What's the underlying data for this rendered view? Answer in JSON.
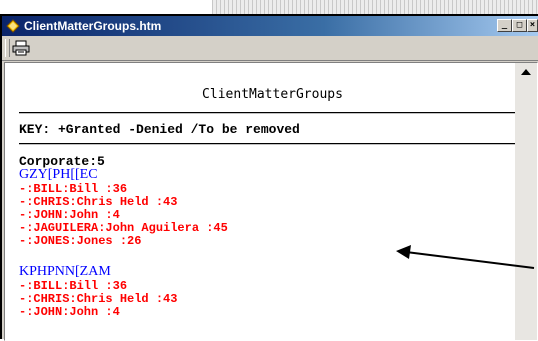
{
  "window": {
    "title": "ClientMatterGroups.htm",
    "controls": {
      "minimize": "_",
      "maximize": "□",
      "close": "×"
    }
  },
  "toolbar": {
    "print_icon": "printer-icon"
  },
  "document": {
    "title": "ClientMatterGroups",
    "key_line": "KEY: +Granted -Denied /To be removed",
    "section_header": "Corporate:5",
    "groups": [
      {
        "name": "GZY[PH[[EC",
        "members": [
          "-:BILL:Bill :36",
          "-:CHRIS:Chris Held :43",
          "-:JOHN:John :4",
          "-:JAGUILERA:John Aguilera :45",
          "-:JONES:Jones :26"
        ]
      },
      {
        "name": "KPHPNN[ZAM",
        "members": [
          "-:BILL:Bill :36",
          "-:CHRIS:Chris Held :43",
          "-:JOHN:John :4"
        ]
      }
    ]
  },
  "colors": {
    "group_name": "#0000ff",
    "member": "#ff0000",
    "titlebar_start": "#0a246a",
    "titlebar_end": "#a6caf0",
    "annotation_arrow": "#000000"
  }
}
